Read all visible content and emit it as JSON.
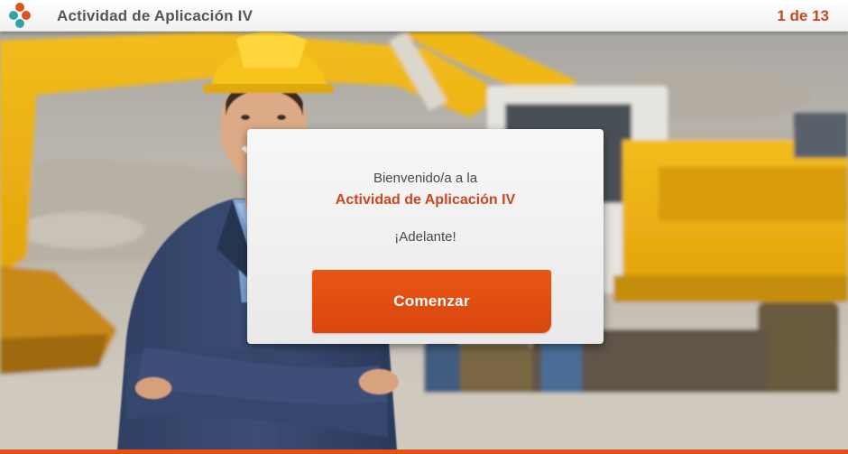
{
  "header": {
    "title": "Actividad de Aplicación IV",
    "page_counter": "1 de 13",
    "logo_icon": "four-dot-flower-logo"
  },
  "dialog": {
    "welcome_text": "Bienvenido/a a la",
    "activity_name": "Actividad de Aplicación IV",
    "cheer_text": "¡Adelante!",
    "start_button_label": "Comenzar"
  },
  "colors": {
    "accent": "#e0521c",
    "title_accent": "#c8471f",
    "header_text": "#555555",
    "card_background": "#f2f2f2"
  }
}
